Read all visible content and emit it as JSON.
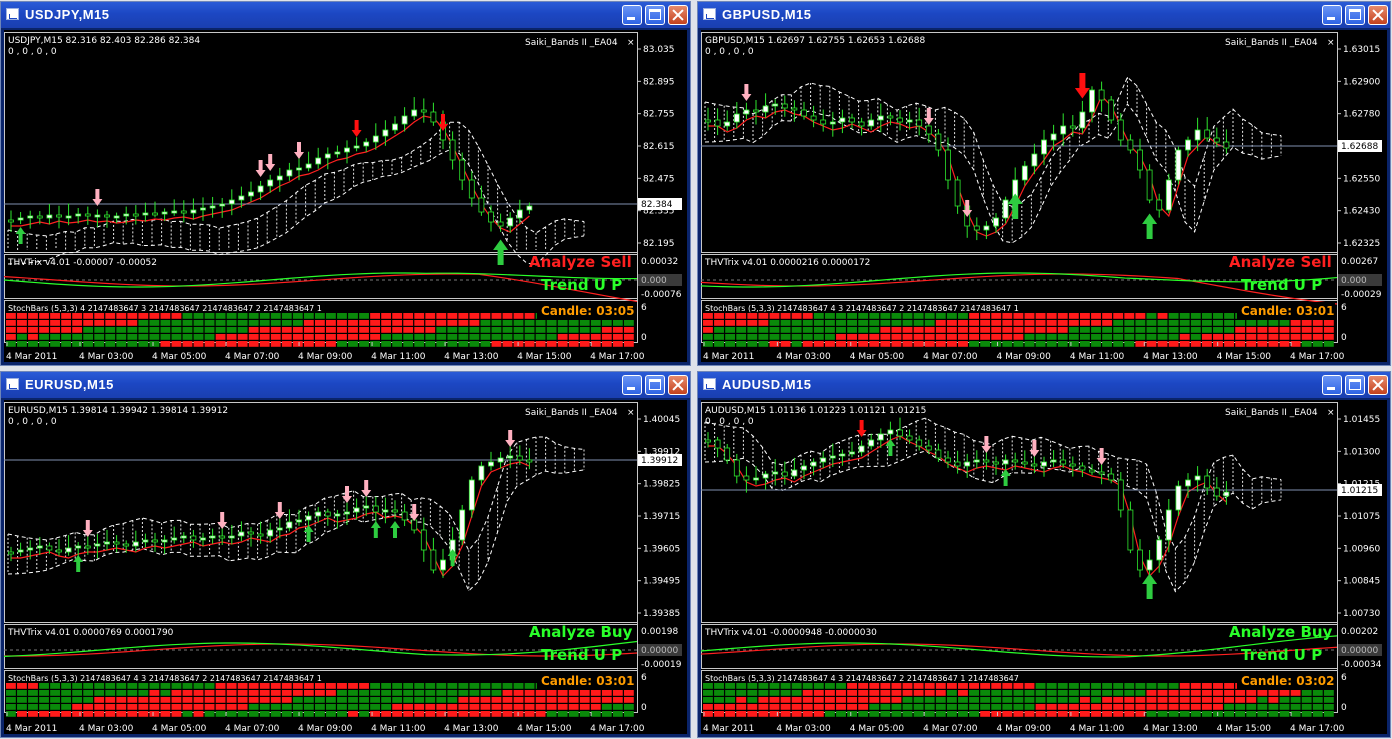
{
  "windows": [
    {
      "id": "usdjpy",
      "title": "USDJPY,M15",
      "info_line": "USDJPY,M15  82.316 82.403 82.286 82.384",
      "info_zeros": "0 , 0 , 0 , 0",
      "ea_label": "Saiki_Bands II _EA04",
      "close_mark": "×",
      "price_labels": [
        "83.035",
        "82.895",
        "82.755",
        "82.615",
        "82.475",
        "82.335",
        "82.195"
      ],
      "current_price": "82.384",
      "trix_label": "THVTrix v4.01 -0.00007 -0.00052",
      "trix_levels": [
        "0.00032",
        "0.000",
        "-0.00076"
      ],
      "analyze_text": "Analyze Sell",
      "analyze_color": "#ff2020",
      "trend_text": "Trend U P",
      "stoch_label": "StochBars (5,3,3) 4 2147483647 3 2147483647 2147483647 2 2147483647 1",
      "stoch_levels": [
        "6",
        "0"
      ],
      "candle_text": "Candle:  03:05",
      "time_labels": [
        "4 Mar 2011",
        "4 Mar 03:00",
        "4 Mar 05:00",
        "4 Mar 07:00",
        "4 Mar 09:00",
        "4 Mar 11:00",
        "4 Mar 13:00",
        "4 Mar 15:00",
        "4 Mar 17:00"
      ]
    },
    {
      "id": "gbpusd",
      "title": "GBPUSD,M15",
      "info_line": "GBPUSD,M15  1.62697 1.62755 1.62653 1.62688",
      "info_zeros": "0 , 0 , 0 , 0",
      "ea_label": "Saiki_Bands II _EA04",
      "close_mark": "×",
      "price_labels": [
        "1.63015",
        "1.62900",
        "1.62780",
        "1.62688",
        "1.62550",
        "1.62430",
        "1.62325"
      ],
      "current_price": "1.62688",
      "trix_label": "THVTrix v4.01 0.0000216 0.0000172",
      "trix_levels": [
        "0.00267",
        "0.000",
        "-0.00029"
      ],
      "analyze_text": "Analyze Sell",
      "analyze_color": "#ff2020",
      "trend_text": "Trend U P",
      "stoch_label": "StochBars (5,3,3) 2147483647 4 3 2147483647 2 2147483647 2147483647 1",
      "stoch_levels": [
        "6",
        "0"
      ],
      "candle_text": "Candle:  03:01",
      "time_labels": [
        "4 Mar 2011",
        "4 Mar 03:00",
        "4 Mar 05:00",
        "4 Mar 07:00",
        "4 Mar 09:00",
        "4 Mar 11:00",
        "4 Mar 13:00",
        "4 Mar 15:00",
        "4 Mar 17:00"
      ]
    },
    {
      "id": "eurusd",
      "title": "EURUSD,M15",
      "info_line": "EURUSD,M15  1.39814 1.39942 1.39814 1.39912",
      "info_zeros": "0 , 0 , 0 , 0",
      "ea_label": "Saiki_Bands II _EA04",
      "close_mark": "×",
      "price_labels": [
        "1.40045",
        "1.39912",
        "1.39825",
        "1.39715",
        "1.39605",
        "1.39495",
        "1.39385"
      ],
      "current_price": "1.39912",
      "trix_label": "THVTrix v4.01 0.0000769 0.0001790",
      "trix_levels": [
        "0.00198",
        "0.00000",
        "-0.00019"
      ],
      "analyze_text": "Analyze Buy",
      "analyze_color": "#2aff2a",
      "trend_text": "Trend U P",
      "stoch_label": "StochBars (5,3,3) 2147483647 4 3 2147483647 2 2147483647 2147483647 1",
      "stoch_levels": [
        "6",
        "0"
      ],
      "candle_text": "Candle:  03:01",
      "time_labels": [
        "4 Mar 2011",
        "4 Mar 03:00",
        "4 Mar 05:00",
        "4 Mar 07:00",
        "4 Mar 09:00",
        "4 Mar 11:00",
        "4 Mar 13:00",
        "4 Mar 15:00",
        "4 Mar 17:00"
      ]
    },
    {
      "id": "audusd",
      "title": "AUDUSD,M15",
      "info_line": "AUDUSD,M15  1.01136 1.01223 1.01121 1.01215",
      "info_zeros": "0 , 0 , 0 , 0",
      "ea_label": "Saiki_Bands II _EA04",
      "close_mark": "×",
      "price_labels": [
        "1.01455",
        "1.01300",
        "1.01215",
        "1.01075",
        "1.00960",
        "1.00845",
        "1.00730"
      ],
      "current_price": "1.01215",
      "trix_label": "THVTrix v4.01 -0.0000948 -0.0000030",
      "trix_levels": [
        "0.00202",
        "0.00000",
        "-0.00034"
      ],
      "analyze_text": "Analyze Buy",
      "analyze_color": "#2aff2a",
      "trend_text": "Trend U P",
      "stoch_label": "StochBars (5,3,3) 2147483647 4 3 2147483647 2 2147483647 1 2147483647",
      "stoch_levels": [
        "6",
        "0"
      ],
      "candle_text": "Candle:  03:02",
      "time_labels": [
        "4 Mar 2011",
        "4 Mar 03:00",
        "4 Mar 05:00",
        "4 Mar 07:00",
        "4 Mar 09:00",
        "4 Mar 11:00",
        "4 Mar 13:00",
        "4 Mar 15:00",
        "4 Mar 17:00"
      ]
    }
  ],
  "colors": {
    "bull_candle": "#ffffff",
    "bear_candle": "#000000",
    "wick": "#2ee62e",
    "trend_green": "#2aff2a",
    "stoch_green": "#0a8a0a",
    "stoch_red": "#ff1a1a",
    "arrow_pink": "#ffb0c0",
    "arrow_red": "#ff1010",
    "arrow_green": "#2ecc40",
    "candle_timer": "#ff9c00"
  }
}
